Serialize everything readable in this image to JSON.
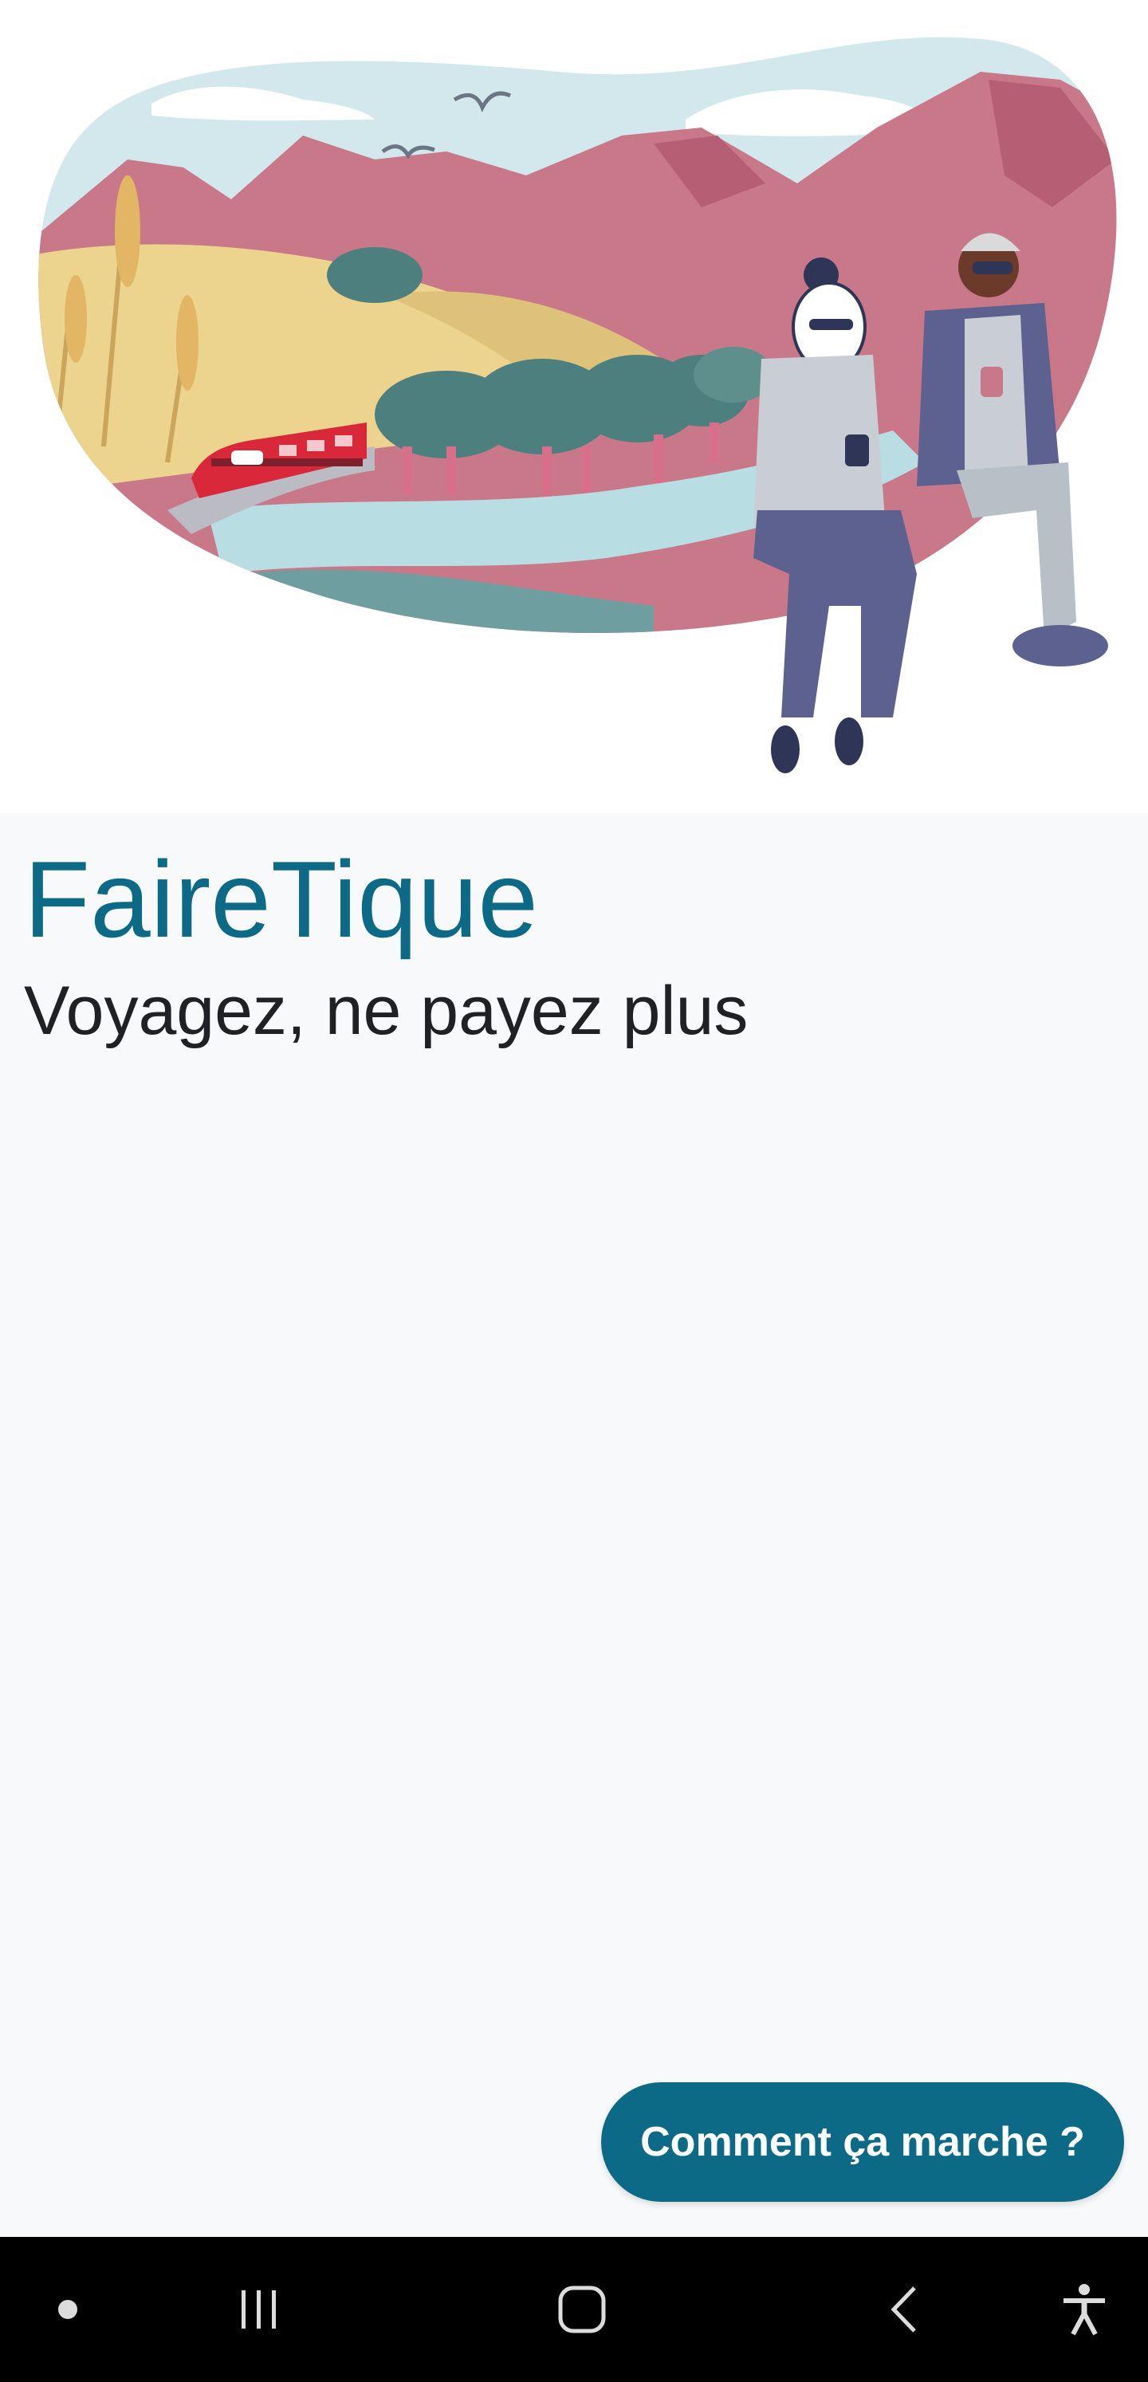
{
  "app": {
    "title": "FaireTique",
    "subtitle": "Voyagez, ne payez plus"
  },
  "actions": {
    "how_it_works_label": "Comment ça marche ?"
  },
  "navigation_bar": {
    "items": [
      {
        "icon": "dot-indicator-icon"
      },
      {
        "icon": "recent-apps-icon"
      },
      {
        "icon": "home-icon"
      },
      {
        "icon": "back-icon"
      },
      {
        "icon": "accessibility-icon"
      }
    ]
  },
  "colors": {
    "brand": "#0d6a86",
    "text": "#202124",
    "background": "#f8f9fb",
    "nav_background": "#000000",
    "illustration_mountains": "#c97889",
    "illustration_sky": "#d3e8ec",
    "illustration_fields": "#ecd48f",
    "illustration_trees": "#4e7f7f",
    "illustration_train": "#d8283a"
  }
}
